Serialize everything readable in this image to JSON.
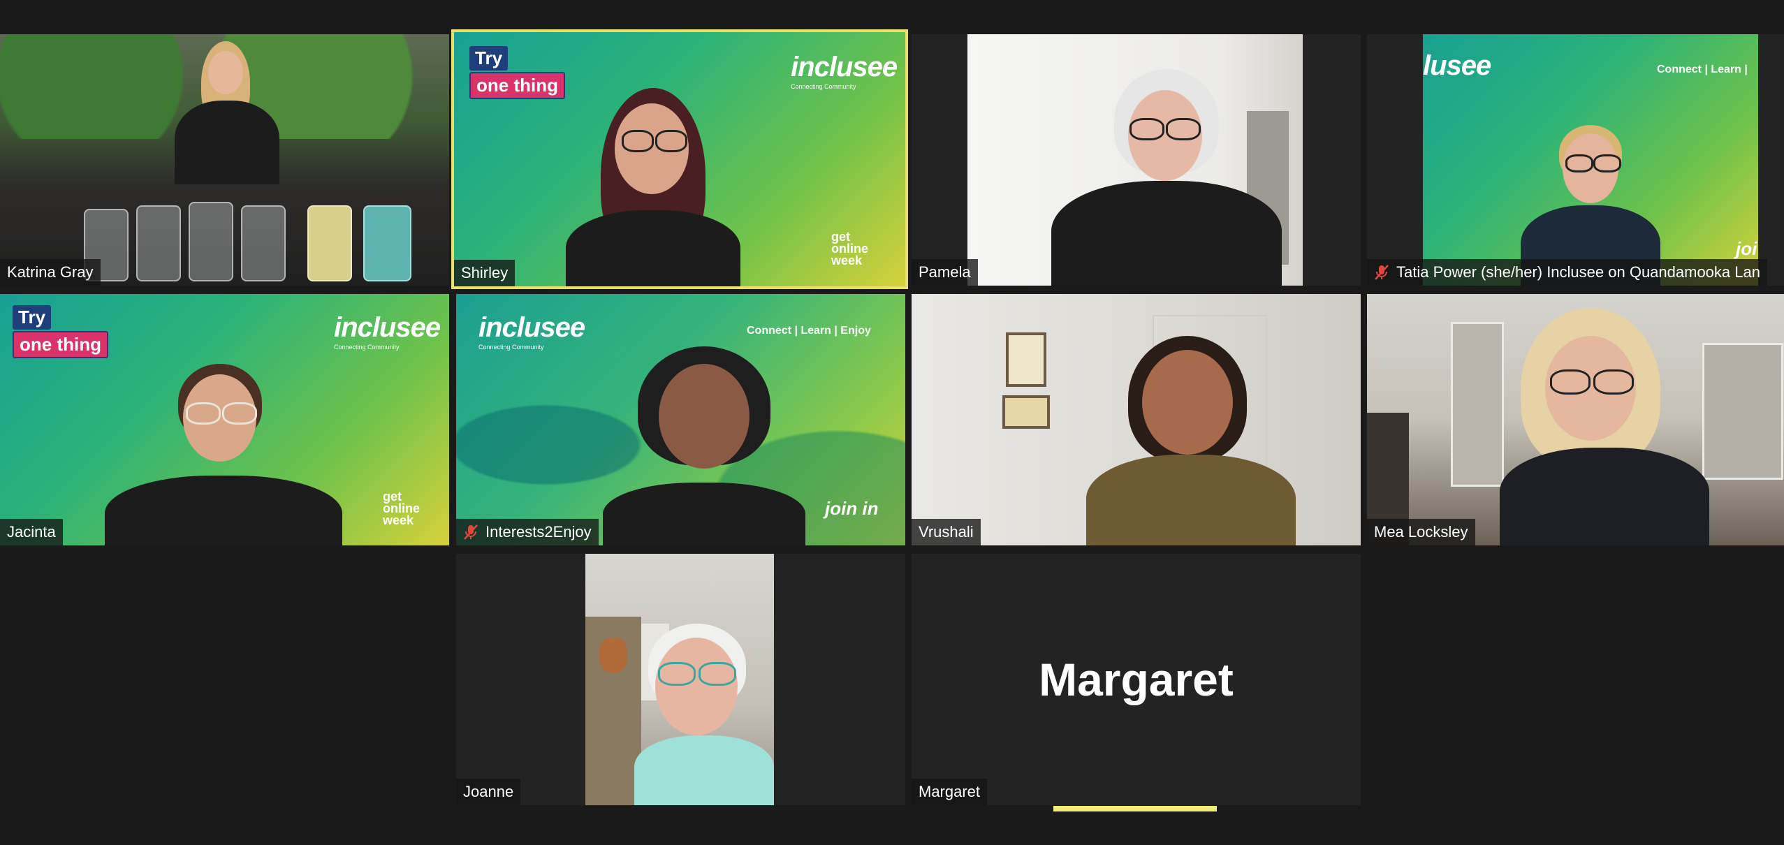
{
  "participants": [
    {
      "name": "Katrina Gray",
      "muted": false
    },
    {
      "name": "Shirley",
      "muted": false,
      "active_speaker": true
    },
    {
      "name": "Pamela",
      "muted": false
    },
    {
      "name": "Tatia Power (she/her) Inclusee on Quandamooka Lan",
      "muted": true
    },
    {
      "name": "Jacinta",
      "muted": false
    },
    {
      "name": "Interests2Enjoy",
      "muted": true
    },
    {
      "name": "Vrushali",
      "muted": false
    },
    {
      "name": "Mea Locksley",
      "muted": false
    },
    {
      "name": "Joanne",
      "muted": false
    },
    {
      "name": "Margaret",
      "muted": false,
      "video_off": true
    }
  ],
  "branding": {
    "logo": "inclusee",
    "logo_sub": "Connecting Community",
    "try": "Try",
    "one_thing": "one thing",
    "tagline": "Connect | Learn | Enjoy",
    "tagline_cut": "Connect | Learn |",
    "get": "get",
    "online": "online",
    "week": "week",
    "join_in": "join in",
    "logo_cut": "lusee",
    "join_cut": "joi"
  },
  "colors": {
    "active_border": "#e8e06a",
    "background": "#1a1a1a",
    "mute_icon": "#e0483e"
  },
  "icons": {
    "mute": "mic-off-icon"
  }
}
